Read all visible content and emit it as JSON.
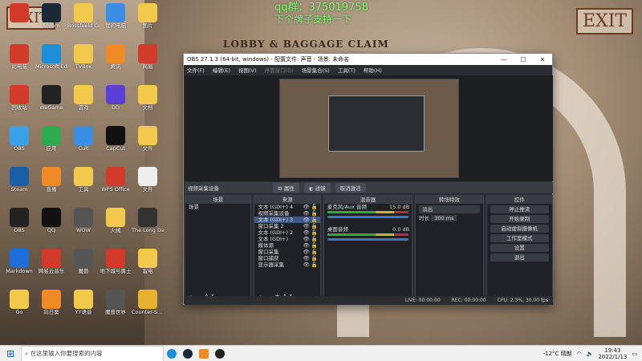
{
  "overlay": {
    "qq": "qq群：375019758",
    "line2": "下个牌子支持一下"
  },
  "background": {
    "exit_left": "EXIT",
    "exit_right": "EXIT",
    "banner": "LOBBY & BAGGAGE CLAIM"
  },
  "desktop_icons": [
    {
      "label": "",
      "color": "#d23a2a"
    },
    {
      "label": "Steam",
      "color": "#1b2838"
    },
    {
      "label": "Bossfeeld Ccd",
      "color": "#f2c94c"
    },
    {
      "label": "我的电脑",
      "color": "#3a8ee6"
    },
    {
      "label": "图片",
      "color": "#f2c94c"
    },
    {
      "label": "此电脑",
      "color": "#d23a2a"
    },
    {
      "label": "Microsoft Edge",
      "color": "#1d8fd8"
    },
    {
      "label": "TVBox",
      "color": "#f2c94c"
    },
    {
      "label": "腾讯",
      "color": "#f08a24"
    },
    {
      "label": "网易",
      "color": "#d23a2a"
    },
    {
      "label": "回收站",
      "color": "#d23a2a"
    },
    {
      "label": "WeGame",
      "color": "#222"
    },
    {
      "label": "游戏",
      "color": "#f2c94c"
    },
    {
      "label": "DD",
      "color": "#5a3fd6"
    },
    {
      "label": "文档",
      "color": "#f2c94c"
    },
    {
      "label": "OBS",
      "color": "#3aa0e8"
    },
    {
      "label": "应用",
      "color": "#2faa4f"
    },
    {
      "label": "Cult",
      "color": "#3a8ee6"
    },
    {
      "label": "CapCut",
      "color": "#111"
    },
    {
      "label": "文件",
      "color": "#f2c94c"
    },
    {
      "label": "Steam",
      "color": "#1a5fa6"
    },
    {
      "label": "直播",
      "color": "#f08a24"
    },
    {
      "label": "工具",
      "color": "#f2c94c"
    },
    {
      "label": "WPS Office",
      "color": "#d23a2a"
    },
    {
      "label": "文件",
      "color": "#eee"
    },
    {
      "label": "OBS",
      "color": "#222"
    },
    {
      "label": "QQ",
      "color": "#111"
    },
    {
      "label": "WOW",
      "color": "#555"
    },
    {
      "label": "火绒",
      "color": "#f2c94c"
    },
    {
      "label": "The Long Dark",
      "color": "#333"
    },
    {
      "label": "Markdown",
      "color": "#1d6ed8"
    },
    {
      "label": "网易云音乐",
      "color": "#d23a2a"
    },
    {
      "label": "魔兽",
      "color": "#555"
    },
    {
      "label": "地下城与勇士",
      "color": "#d23a2a"
    },
    {
      "label": "雷电",
      "color": "#f2c94c"
    },
    {
      "label": "Go",
      "color": "#f2c94c"
    },
    {
      "label": "向日葵",
      "color": "#f08a24"
    },
    {
      "label": "YY语音",
      "color": "#f2c94c"
    },
    {
      "label": "魔兽世界",
      "color": "#555"
    },
    {
      "label": "Counter-S... Global Off...",
      "color": "#e8b030"
    }
  ],
  "obs": {
    "title": "OBS 27.1.3 (64-bit, windows) - 配置文件: 声音 - 场景: 未命名",
    "menu": [
      "文件(F)",
      "编辑(E)",
      "视图(V)",
      "停靠窗口(D)",
      "场景集合(S)",
      "工具(T)",
      "帮助(H)"
    ],
    "menu_dim": [
      false,
      false,
      false,
      true,
      false,
      false,
      false
    ],
    "source_bar": {
      "label": "视频采集设备",
      "props": "属性",
      "filters": "滤镜",
      "deactivate": "取消激活"
    },
    "scenes": {
      "title": "场景",
      "items": [
        "场景"
      ]
    },
    "sources": {
      "title": "来源",
      "items": [
        "文本 (GDI+) 4",
        "视频采集设备",
        "文本 (GDI+) 3",
        "窗口采集 2",
        "文本 (GDI+) 2",
        "文本 (GDI+)",
        "媒体源",
        "窗口采集",
        "窗口捕获",
        "显示器采集"
      ],
      "selected": 2
    },
    "mixer": {
      "title": "混音器",
      "ch1": "麦克风/Aux 音频",
      "ch1_db": "15.0 dB",
      "ch2": "桌面音频",
      "ch2_db": "0.0 dB"
    },
    "transitions": {
      "title": "转场特效",
      "type": "淡出",
      "duration_label": "时长",
      "duration": "300 ms"
    },
    "controls": {
      "title": "控件",
      "buttons": [
        "停止推流",
        "开始录制",
        "启动虚拟摄像机",
        "工作室模式",
        "设置",
        "退出"
      ]
    },
    "status": {
      "live": "LIVE: 00:00:00",
      "rec": "REC: 00:00:00",
      "cpu": "CPU: 2.3%, 30.00 fps"
    }
  },
  "taskbar": {
    "search_placeholder": "在这里输入你要搜索的内容",
    "temp": "-12°C 晴朗",
    "time": "19:43",
    "date": "2022/1/13"
  }
}
